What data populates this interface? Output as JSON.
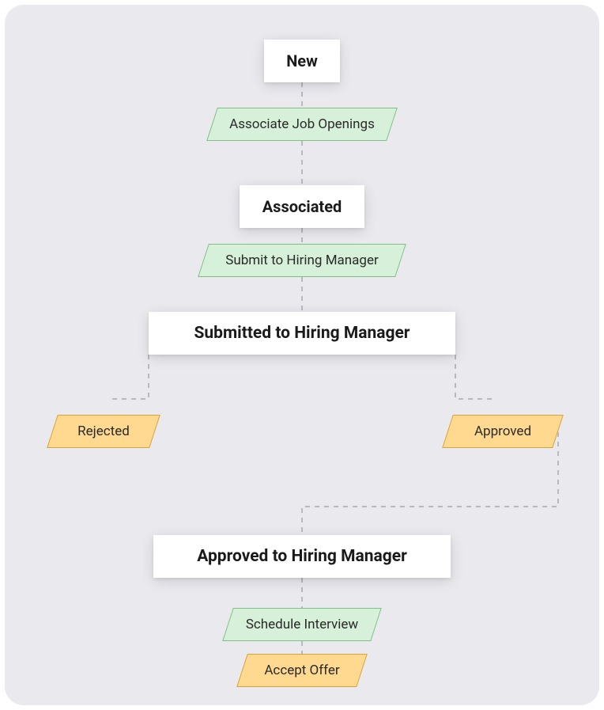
{
  "nodes": {
    "new": "New",
    "associated": "Associated",
    "submitted": "Submitted to Hiring Manager",
    "approved_mgr": "Approved to Hiring Manager"
  },
  "actions": {
    "associate_openings": "Associate Job Openings",
    "submit_hiring": "Submit to Hiring Manager",
    "rejected": "Rejected",
    "approved": "Approved",
    "schedule_interview": "Schedule Interview",
    "accept_offer": "Accept Offer"
  },
  "colors": {
    "node_bg": "#ffffff",
    "action_green_bg": "#d6f0d9",
    "action_green_border": "#7fbf86",
    "action_orange_bg": "#ffd98f",
    "action_orange_border": "#d9a23a",
    "canvas_bg": "#e9e9ee",
    "connector": "#b8b8c0"
  }
}
